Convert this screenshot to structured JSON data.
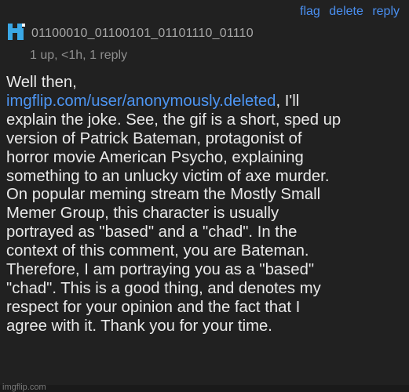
{
  "actions": {
    "flag": "flag",
    "delete": "delete",
    "reply": "reply"
  },
  "user": {
    "name": "01100010_01100101_01101110_01110",
    "meta": "1 up, <1h, 1 reply"
  },
  "comment": {
    "intro": "Well then,\n",
    "link": "imgflip.com/user/anonymously.deleted",
    "after_link": ", I'll\n",
    "text": "explain the joke. See, the gif is a short, sped up\nversion of Patrick Bateman, protagonist of\nhorror movie American Psycho, explaining\nsomething to an unlucky victim of axe murder.\nOn popular meming stream the Mostly Small\nMemer Group, this character is usually\nportrayed as \"based\" and a \"chad\". In the\ncontext of this comment, you are Bateman.\nTherefore, I am portraying you as a \"based\"\n\"chad\". This is a good thing, and denotes my\nrespect for your opinion and the fact that I\nagree with it. Thank you for your time."
  },
  "watermark": "imgflip.com",
  "colors": {
    "background": "#212121",
    "link": "#4d95f2",
    "avatar": "#3aa8e6"
  },
  "icons": {
    "avatar": "pixel-avatar-icon"
  }
}
